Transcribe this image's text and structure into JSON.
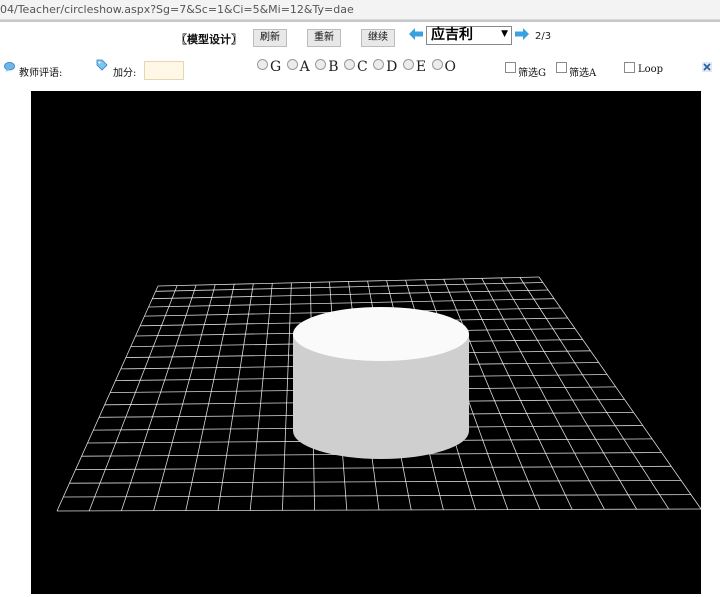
{
  "address_bar": {
    "url": "04/Teacher/circleshow.aspx?Sg=7&Sc=1&Ci=5&Mi=12&Ty=dae"
  },
  "toolbar": {
    "title": "〖模型设计〗",
    "refresh_label": "刷新",
    "restart_label": "重新",
    "continue_label": "继续",
    "student_selected": "应吉利",
    "page_current": "2",
    "page_total": "3",
    "page_text": "2/3"
  },
  "review": {
    "comment_label": "教师评语:",
    "score_label": "加分:",
    "score_value": "",
    "grades": [
      "G",
      "A",
      "B",
      "C",
      "D",
      "E",
      "O"
    ],
    "filter_g_label": "筛选G",
    "filter_a_label": "筛选A",
    "loop_label": "Loop"
  },
  "colors": {
    "viewport_bg": "#000000",
    "grid": "#ffffff",
    "cylinder_top": "#fafafa",
    "cylinder_side": "#cfcfcf",
    "arrow": "#3aa0e0"
  },
  "icons": {
    "prev": "left-arrow-icon",
    "next": "right-arrow-icon",
    "comment": "speech-bubble-icon",
    "score": "tag-icon",
    "close": "close-icon"
  }
}
